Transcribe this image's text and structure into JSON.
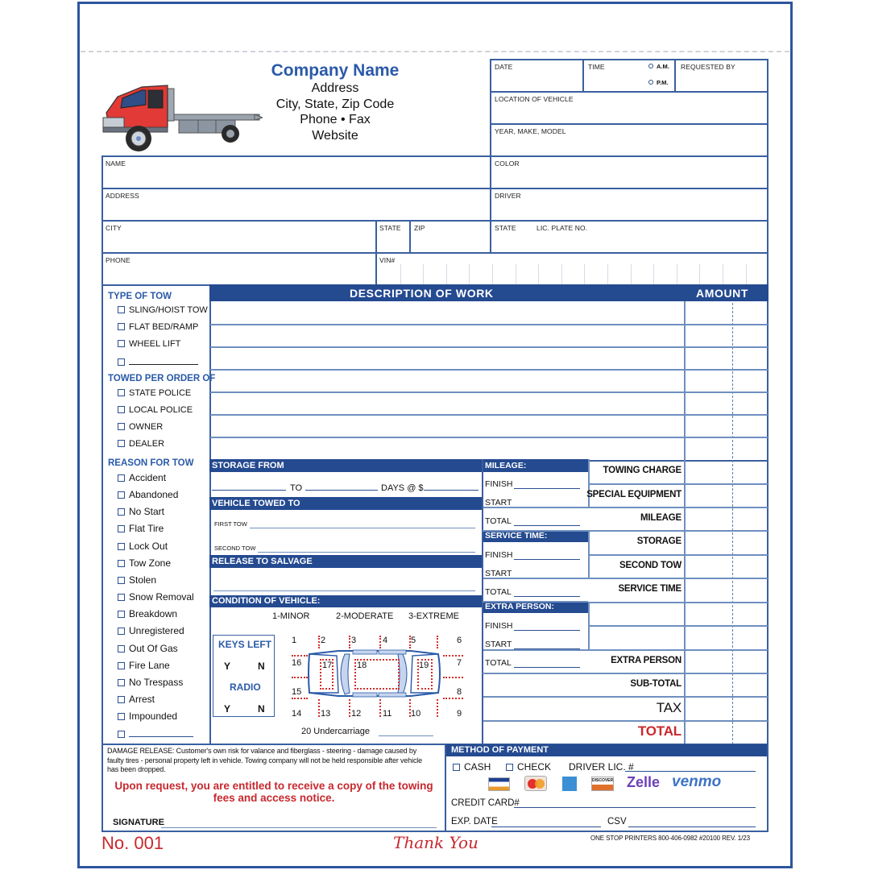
{
  "header": {
    "company_name": "Company Name",
    "address": "Address",
    "city_state_zip": "City, State, Zip Code",
    "phone_fax": "Phone • Fax",
    "website": "Website",
    "logo_icon": "flatbed-tow-truck"
  },
  "top_right": {
    "date": "DATE",
    "time": "TIME",
    "am": "A.M.",
    "pm": "P.M.",
    "requested_by": "REQUESTED BY",
    "location": "LOCATION OF VEHICLE",
    "year_make_model": "YEAR, MAKE, MODEL"
  },
  "customer": {
    "name": "NAME",
    "color": "COLOR",
    "address": "ADDRESS",
    "driver": "DRIVER",
    "city": "CITY",
    "state": "STATE",
    "zip": "ZIP",
    "plate_state": "STATE",
    "lic_plate": "LIC. PLATE NO.",
    "phone": "PHONE",
    "vin": "VIN#"
  },
  "sidebar": {
    "type_of_tow": {
      "heading": "TYPE OF TOW",
      "items": [
        "SLING/HOIST TOW",
        "FLAT BED/RAMP",
        "WHEEL LIFT",
        ""
      ]
    },
    "towed_per_order": {
      "heading": "TOWED PER ORDER OF",
      "items": [
        "STATE POLICE",
        "LOCAL POLICE",
        "OWNER",
        "DEALER"
      ]
    },
    "reason_for_tow": {
      "heading": "REASON FOR TOW",
      "items": [
        "Accident",
        "Abandoned",
        "No Start",
        "Flat Tire",
        "Lock Out",
        "Tow Zone",
        "Stolen",
        "Snow Removal",
        "Breakdown",
        "Unregistered",
        "Out Of Gas",
        "Fire Lane",
        "No Trespass",
        "Arrest",
        "Impounded",
        ""
      ]
    }
  },
  "work": {
    "description_header": "DESCRIPTION OF WORK",
    "amount_header": "AMOUNT"
  },
  "storage": {
    "heading": "STORAGE FROM",
    "to": "TO",
    "days_at": "DAYS @ $"
  },
  "towed_to": {
    "heading": "VEHICLE TOWED TO",
    "first_tow": "FIRST TOW",
    "second_tow": "SECOND TOW"
  },
  "salvage": {
    "heading": "RELEASE TO SALVAGE"
  },
  "condition": {
    "heading": "CONDITION OF VEHICLE:",
    "scale": [
      "1-MINOR",
      "2-MODERATE",
      "3-EXTREME"
    ],
    "keys_left": "KEYS LEFT",
    "radio": "RADIO",
    "yes": "Y",
    "no": "N",
    "zones_top": [
      "1",
      "2",
      "3",
      "4",
      "5",
      "6"
    ],
    "zones_bottom": [
      "14",
      "13",
      "12",
      "11",
      "10",
      "9"
    ],
    "zones_left": [
      "16",
      "15"
    ],
    "zones_right": [
      "7",
      "8"
    ],
    "zones_inner": [
      "17",
      "18",
      "19"
    ],
    "undercarriage": "20 Undercarriage"
  },
  "mileage": {
    "heading": "MILEAGE:",
    "finish": "FINISH",
    "start": "START",
    "total": "TOTAL"
  },
  "service_time": {
    "heading": "SERVICE TIME:",
    "finish": "FINISH",
    "start": "START",
    "total": "TOTAL"
  },
  "extra_person": {
    "heading": "EXTRA PERSON:",
    "finish": "FINISH",
    "start": "START",
    "total": "TOTAL"
  },
  "charges": {
    "towing_charge": "TOWING CHARGE",
    "special_equipment": "SPECIAL EQUIPMENT",
    "mileage": "MILEAGE",
    "storage": "STORAGE",
    "second_tow": "SECOND TOW",
    "service_time": "SERVICE TIME",
    "extra_person": "EXTRA PERSON",
    "sub_total": "SUB-TOTAL",
    "tax": "TAX",
    "total": "TOTAL"
  },
  "release": {
    "damage_text": "DAMAGE RELEASE: Customer's own risk for valance and fiberglass - steering - damage caused by faulty tires - personal property left in vehicle. Towing company will not be held responsible after vehicle has been dropped.",
    "notice": "Upon request, you are entitled to receive a copy of the towing fees and access notice.",
    "signature": "SIGNATURE"
  },
  "payment": {
    "heading": "METHOD OF PAYMENT",
    "cash": "CASH",
    "check": "CHECK",
    "driver_lic": "DRIVER LIC. #",
    "cards": [
      "VISA",
      "MasterCard",
      "American Express",
      "DISCOVER"
    ],
    "zelle": "Zelle",
    "venmo": "venmo",
    "credit_card": "CREDIT CARD#",
    "exp_date": "EXP. DATE",
    "csv": "CSV"
  },
  "footer": {
    "number": "No. 001",
    "thank_you": "Thank You",
    "printer": "ONE STOP PRINTERS 800-406-0982 #20100 REV. 1/23"
  },
  "colors": {
    "brand_blue": "#244a90",
    "heading_blue": "#2a5aa8",
    "accent_red": "#c8282e"
  }
}
